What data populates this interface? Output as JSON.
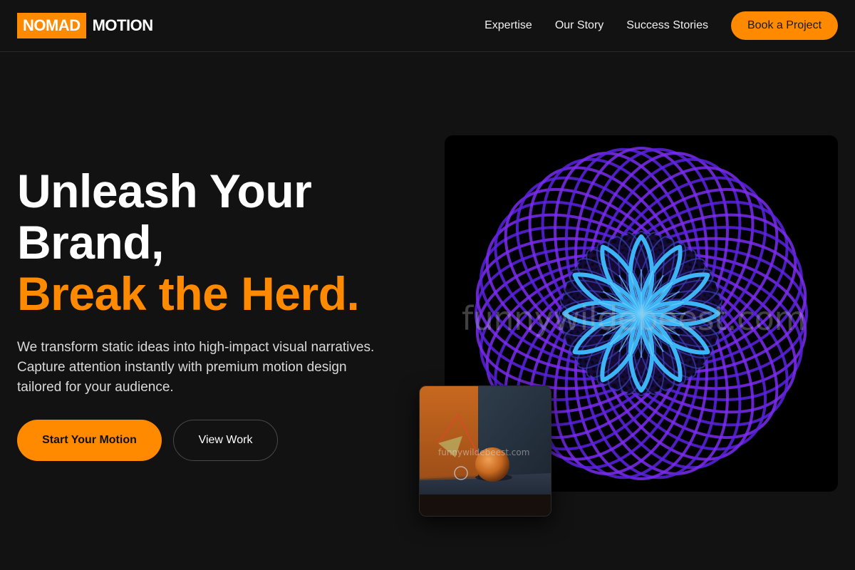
{
  "brand": {
    "logo_box_text": "NOMAD",
    "logo_text": "MOTION",
    "accent_color": "#ff8a00"
  },
  "nav": {
    "links": [
      {
        "label": "Expertise"
      },
      {
        "label": "Our Story"
      },
      {
        "label": "Success Stories"
      }
    ],
    "cta_label": "Book a Project"
  },
  "hero": {
    "title_lines": [
      "Unleash Your",
      "Brand,"
    ],
    "title_accent": "Break the Herd.",
    "description": "We transform static ideas into high-impact visual narratives. Capture attention instantly with premium motion design tailored for your audience.",
    "primary_button": "Start Your Motion",
    "secondary_button": "View Work"
  },
  "media": {
    "main_image": {
      "subject": "purple-torus-with-blue-flower",
      "watermark": "funnywildebeest.com"
    },
    "thumbnail": {
      "subject": "orange-sphere-and-cone-3d-scene",
      "watermark": "funnywildebeest.com"
    }
  }
}
